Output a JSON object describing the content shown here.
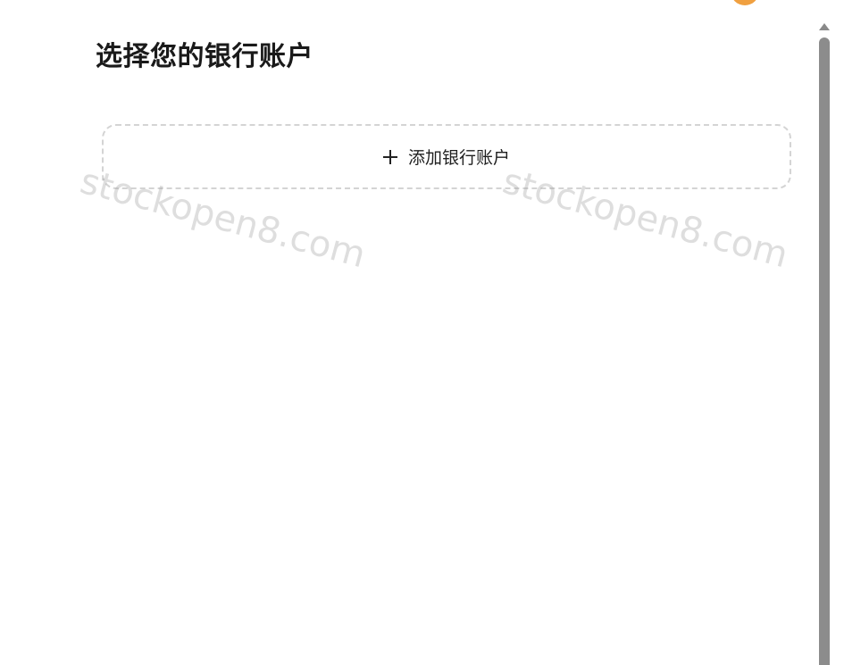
{
  "header": {
    "title": "选择您的银行账户"
  },
  "add_account": {
    "label": "添加银行账户",
    "icon": "plus-icon"
  },
  "watermarks": [
    "stockopen8.com",
    "stockopen8.com"
  ],
  "colors": {
    "border_dashed": "#d4d4d4",
    "scrollbar_thumb": "#8c8c8c",
    "avatar": "#f0a040"
  }
}
